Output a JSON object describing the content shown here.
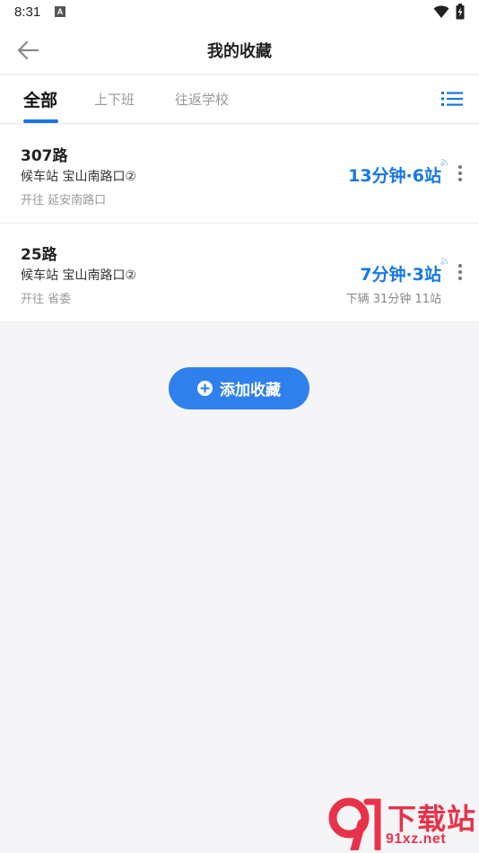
{
  "status_bar": {
    "time": "8:31",
    "notification_icon": "A"
  },
  "header": {
    "title": "我的收藏",
    "back_icon": "arrow-left-icon"
  },
  "tabs": [
    {
      "label": "全部",
      "active": true
    },
    {
      "label": "上下班",
      "active": false
    },
    {
      "label": "往返学校",
      "active": false
    }
  ],
  "favorites": [
    {
      "route": "307路",
      "stop": "候车站 宝山南路口②",
      "direction": "开往 延安南路口",
      "eta": "13分钟·6站",
      "next_bus": ""
    },
    {
      "route": "25路",
      "stop": "候车站 宝山南路口②",
      "direction": "开往 省委",
      "eta": "7分钟·3站",
      "next_bus": "下辆  31分钟 11站"
    }
  ],
  "add_button": {
    "label": "添加收藏"
  },
  "watermark": {
    "text": "下载站",
    "url": "91xz.net"
  },
  "colors": {
    "accent": "#1677e6",
    "button": "#2f80ed",
    "watermark": "#e8324a"
  }
}
